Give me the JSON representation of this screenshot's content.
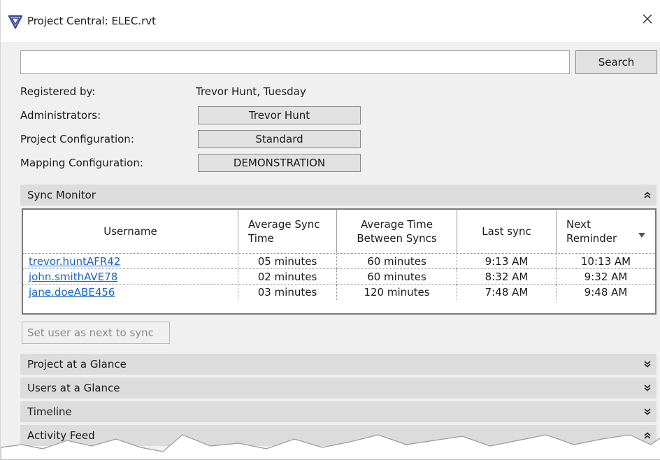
{
  "window": {
    "title": "Project Central: ELEC.rvt",
    "close_glyph": "✕"
  },
  "search": {
    "value": "",
    "placeholder": "",
    "button_label": "Search"
  },
  "info": {
    "registered_label": "Registered by:",
    "registered_value": "Trevor Hunt, Tuesday",
    "administrators_label": "Administrators:",
    "administrators_value": "Trevor Hunt",
    "project_config_label": "Project Configuration:",
    "project_config_value": "Standard",
    "mapping_config_label": "Mapping Configuration:",
    "mapping_config_value": "DEMONSTRATION"
  },
  "sync_monitor": {
    "title": "Sync Monitor",
    "expanded": true,
    "columns": {
      "username": "Username",
      "avg_sync_line1": "Average Sync",
      "avg_sync_line2": "Time",
      "avg_between_line1": "Average Time",
      "avg_between_line2": "Between Syncs",
      "last_sync": "Last sync",
      "next_reminder_line1": "Next",
      "next_reminder_line2": "Reminder"
    },
    "rows": [
      {
        "username": "trevor.huntAFR42",
        "avg_sync": "05 minutes",
        "avg_between": "60 minutes",
        "last_sync": "9:13 AM",
        "next_reminder": "10:13 AM"
      },
      {
        "username": "john.smithAVE78",
        "avg_sync": "02 minutes",
        "avg_between": "60 minutes",
        "last_sync": "8:32 AM",
        "next_reminder": "9:32 AM"
      },
      {
        "username": "jane.doeABE456",
        "avg_sync": "03 minutes",
        "avg_between": "120 minutes",
        "last_sync": "7:48 AM",
        "next_reminder": "9:48 AM"
      }
    ],
    "set_next_button": "Set user as next to sync"
  },
  "sections": [
    {
      "title": "Project at a Glance",
      "expanded": false
    },
    {
      "title": "Users at a Glance",
      "expanded": false
    },
    {
      "title": "Timeline",
      "expanded": false
    },
    {
      "title": "Activity Feed",
      "expanded": true
    }
  ],
  "colors": {
    "link": "#1565c8",
    "section_bg": "#dcdcdc",
    "window_bg": "#f0f0f0",
    "logo_blue": "#3a4a9a"
  },
  "icons": {
    "app": "app-logo-icon",
    "close": "close-icon",
    "collapse": "chevron-double-up-icon",
    "expand": "chevron-double-down-icon",
    "sort": "sort-down-icon"
  }
}
